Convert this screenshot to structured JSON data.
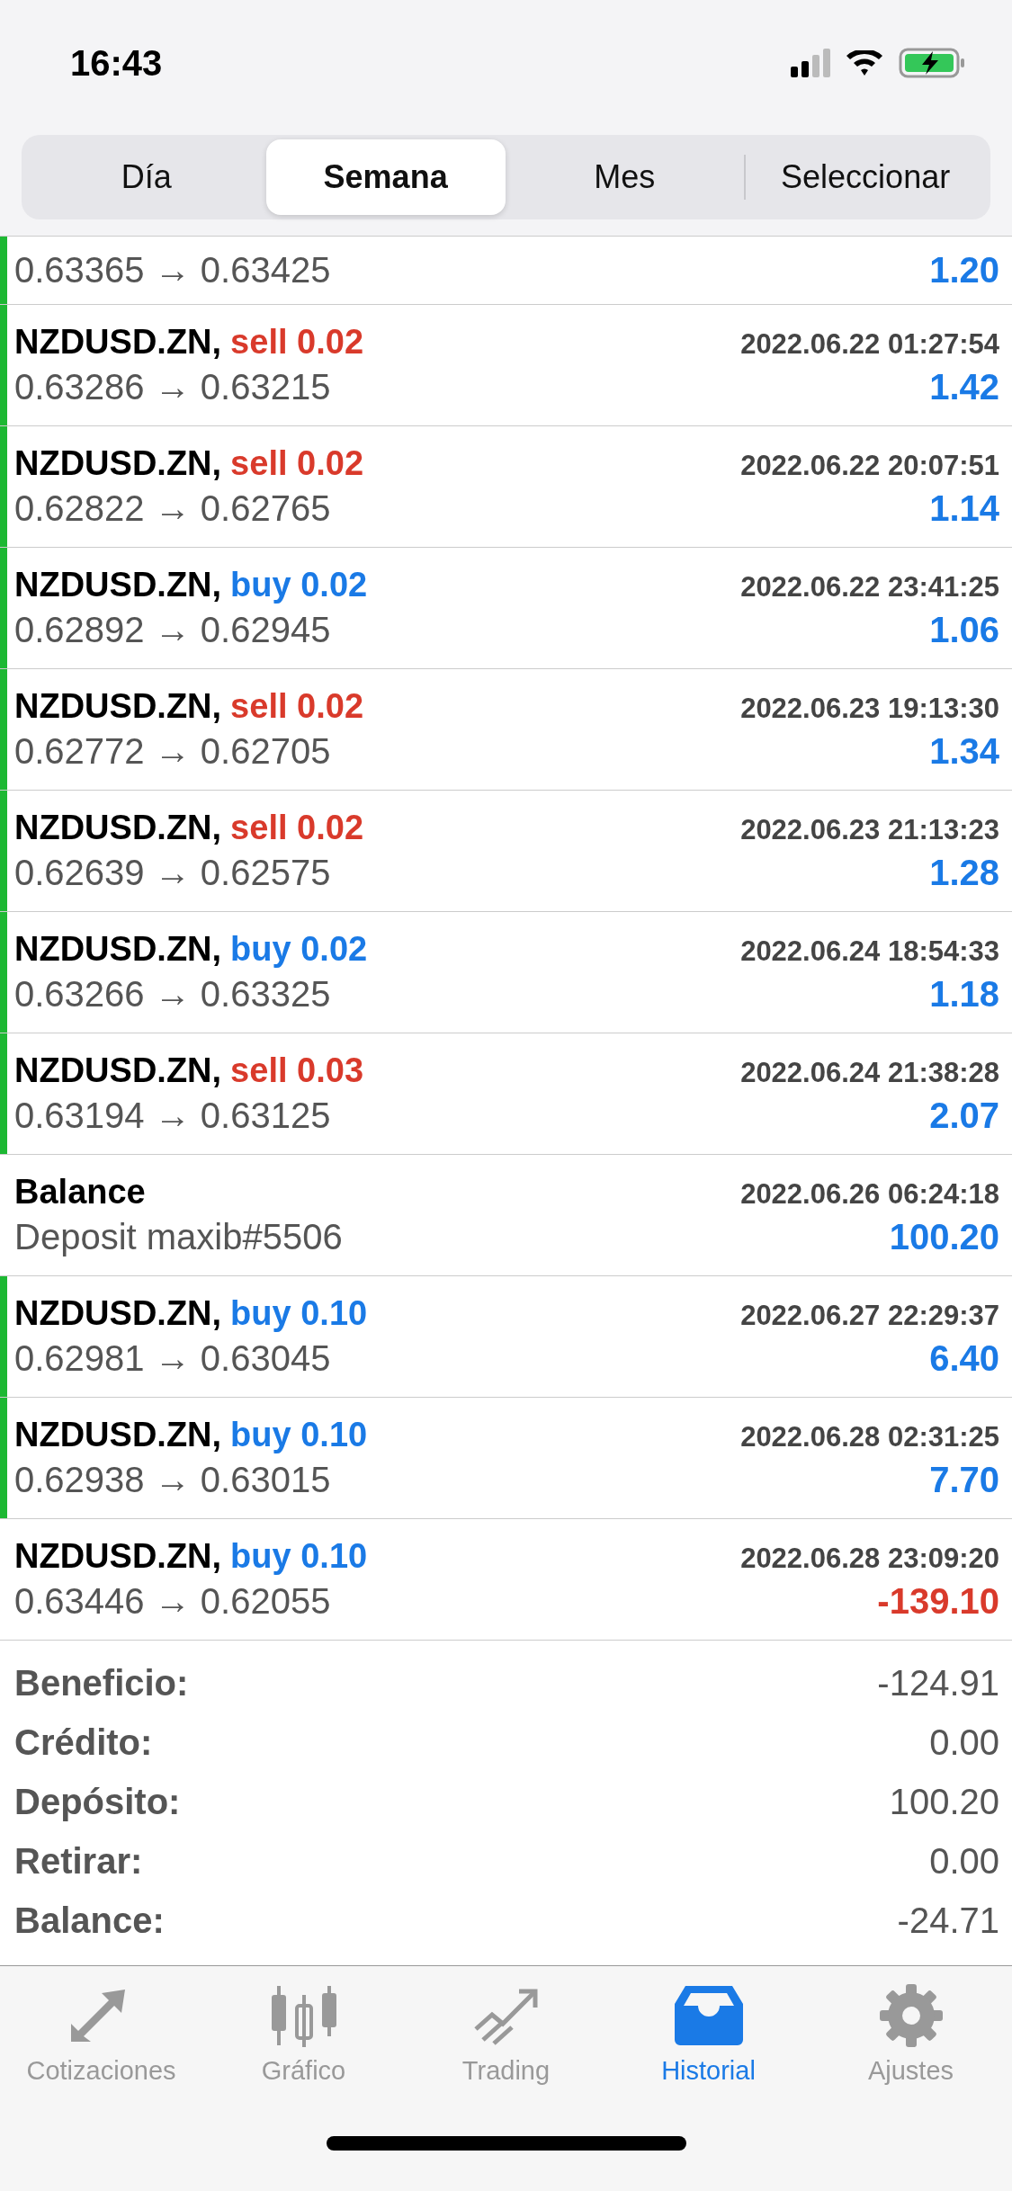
{
  "status_bar": {
    "time": "16:43"
  },
  "period_tabs": [
    {
      "label": "Día",
      "selected": false
    },
    {
      "label": "Semana",
      "selected": true
    },
    {
      "label": "Mes",
      "selected": false
    },
    {
      "label": "Seleccionar",
      "selected": false
    }
  ],
  "deals": [
    {
      "kind": "partial",
      "prices": "0.63365 → 0.63425",
      "profit": "1.20",
      "negative": false,
      "marker": true
    },
    {
      "kind": "trade",
      "symbol": "NZDUSD.ZN,",
      "action": "sell 0.02",
      "is_sell": true,
      "time": "2022.06.22 01:27:54",
      "prices": "0.63286 → 0.63215",
      "profit": "1.42",
      "negative": false,
      "marker": true
    },
    {
      "kind": "trade",
      "symbol": "NZDUSD.ZN,",
      "action": "sell 0.02",
      "is_sell": true,
      "time": "2022.06.22 20:07:51",
      "prices": "0.62822 → 0.62765",
      "profit": "1.14",
      "negative": false,
      "marker": true
    },
    {
      "kind": "trade",
      "symbol": "NZDUSD.ZN,",
      "action": "buy 0.02",
      "is_sell": false,
      "time": "2022.06.22 23:41:25",
      "prices": "0.62892 → 0.62945",
      "profit": "1.06",
      "negative": false,
      "marker": true
    },
    {
      "kind": "trade",
      "symbol": "NZDUSD.ZN,",
      "action": "sell 0.02",
      "is_sell": true,
      "time": "2022.06.23 19:13:30",
      "prices": "0.62772 → 0.62705",
      "profit": "1.34",
      "negative": false,
      "marker": true
    },
    {
      "kind": "trade",
      "symbol": "NZDUSD.ZN,",
      "action": "sell 0.02",
      "is_sell": true,
      "time": "2022.06.23 21:13:23",
      "prices": "0.62639 → 0.62575",
      "profit": "1.28",
      "negative": false,
      "marker": true
    },
    {
      "kind": "trade",
      "symbol": "NZDUSD.ZN,",
      "action": "buy 0.02",
      "is_sell": false,
      "time": "2022.06.24 18:54:33",
      "prices": "0.63266 → 0.63325",
      "profit": "1.18",
      "negative": false,
      "marker": true
    },
    {
      "kind": "trade",
      "symbol": "NZDUSD.ZN,",
      "action": "sell 0.03",
      "is_sell": true,
      "time": "2022.06.24 21:38:28",
      "prices": "0.63194 → 0.63125",
      "profit": "2.07",
      "negative": false,
      "marker": true
    },
    {
      "kind": "balance",
      "symbol": "Balance",
      "time": "2022.06.26 06:24:18",
      "prices": "Deposit maxib#5506",
      "profit": "100.20",
      "negative": false,
      "marker": false
    },
    {
      "kind": "trade",
      "symbol": "NZDUSD.ZN,",
      "action": "buy 0.10",
      "is_sell": false,
      "time": "2022.06.27 22:29:37",
      "prices": "0.62981 → 0.63045",
      "profit": "6.40",
      "negative": false,
      "marker": true
    },
    {
      "kind": "trade",
      "symbol": "NZDUSD.ZN,",
      "action": "buy 0.10",
      "is_sell": false,
      "time": "2022.06.28 02:31:25",
      "prices": "0.62938 → 0.63015",
      "profit": "7.70",
      "negative": false,
      "marker": true
    },
    {
      "kind": "trade",
      "symbol": "NZDUSD.ZN,",
      "action": "buy 0.10",
      "is_sell": false,
      "time": "2022.06.28 23:09:20",
      "prices": "0.63446 → 0.62055",
      "profit": "-139.10",
      "negative": true,
      "marker": false
    }
  ],
  "summary": [
    {
      "label": "Beneficio:",
      "value": "-124.91"
    },
    {
      "label": "Crédito:",
      "value": "0.00"
    },
    {
      "label": "Depósito:",
      "value": "100.20"
    },
    {
      "label": "Retirar:",
      "value": "0.00"
    },
    {
      "label": "Balance:",
      "value": "-24.71"
    }
  ],
  "tab_bar": [
    {
      "label": "Cotizaciones",
      "kind": "quotes",
      "selected": false
    },
    {
      "label": "Gráfico",
      "kind": "chart",
      "selected": false
    },
    {
      "label": "Trading",
      "kind": "trading",
      "selected": false
    },
    {
      "label": "Historial",
      "kind": "history",
      "selected": true
    },
    {
      "label": "Ajustes",
      "kind": "settings",
      "selected": false
    }
  ]
}
